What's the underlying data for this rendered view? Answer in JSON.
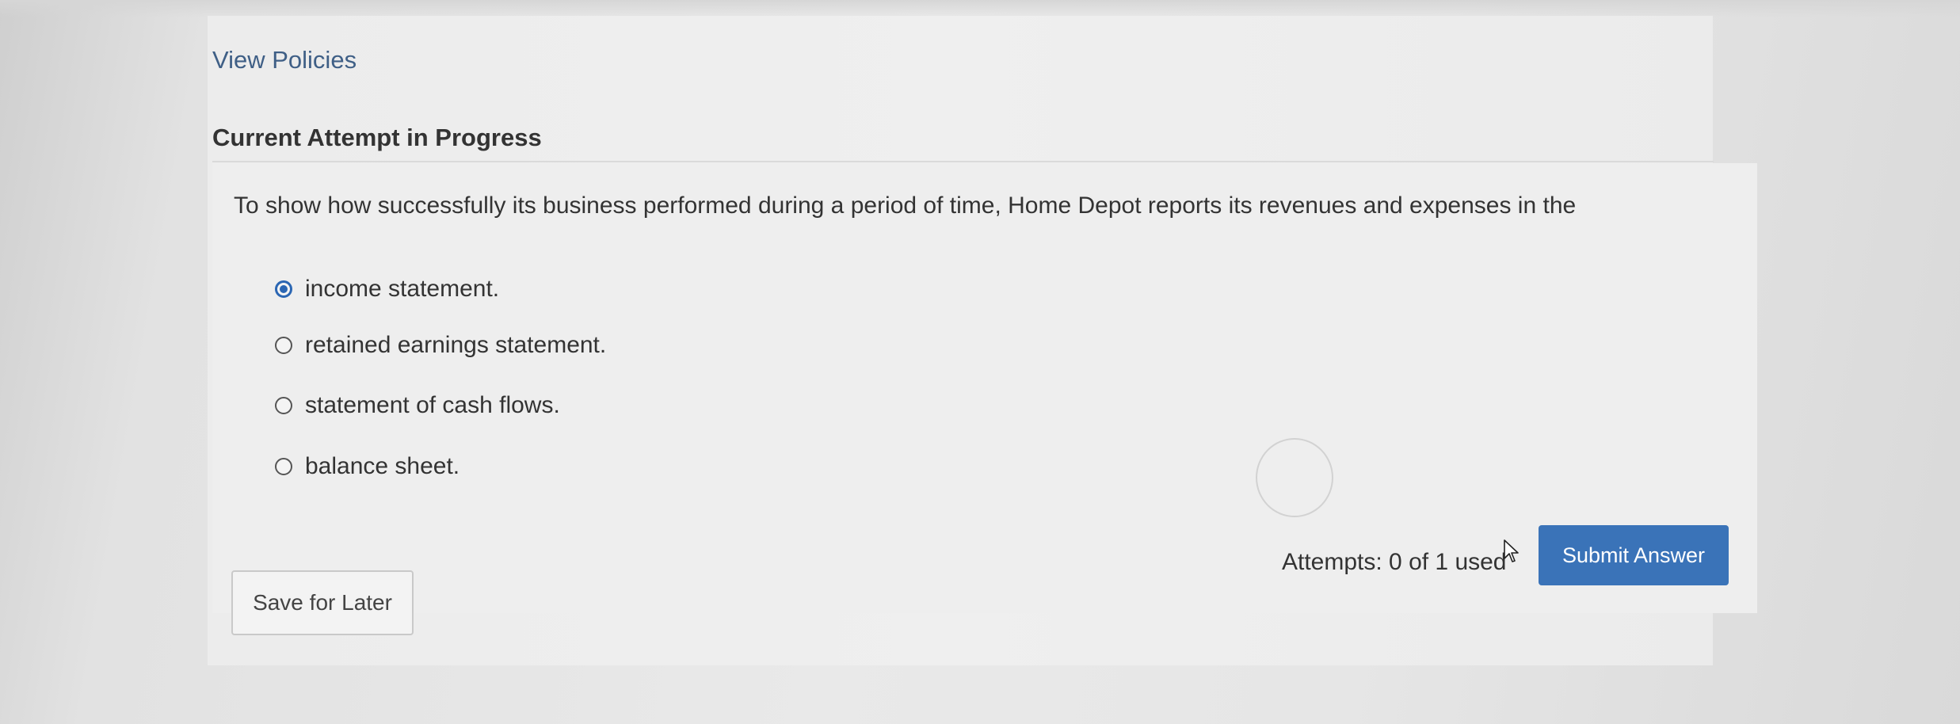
{
  "header": {
    "view_policies_label": "View Policies"
  },
  "attempt": {
    "heading": "Current Attempt in Progress"
  },
  "question": {
    "text": "To show how successfully its business performed during a period of time, Home Depot reports its revenues and expenses in the",
    "options": [
      {
        "label": "income statement.",
        "selected": true
      },
      {
        "label": "retained earnings statement.",
        "selected": false
      },
      {
        "label": "statement of cash flows.",
        "selected": false
      },
      {
        "label": "balance sheet.",
        "selected": false
      }
    ]
  },
  "footer": {
    "attempts_text": "Attempts: 0 of 1 used",
    "submit_label": "Submit Answer",
    "save_label": "Save for Later"
  },
  "colors": {
    "accent": "#3a73b8",
    "link": "#3f5f86"
  }
}
